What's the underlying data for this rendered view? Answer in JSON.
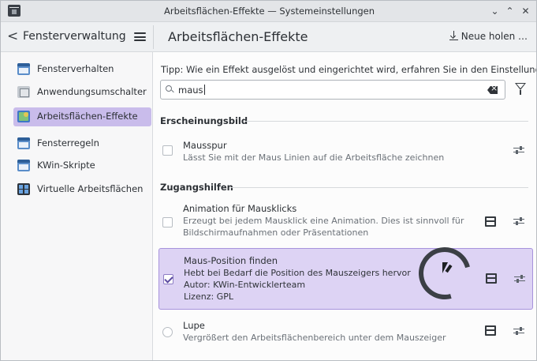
{
  "window": {
    "title": "Arbeitsflächen-Effekte — Systemeinstellungen",
    "controls": [
      "⌄",
      "⌃",
      "✕"
    ]
  },
  "header": {
    "back_label": "<",
    "breadcrumb": "Fensterverwaltung",
    "page_title": "Arbeitsflächen-Effekte",
    "get_new_label": "Neue holen …"
  },
  "sidebar": {
    "items": [
      {
        "label": "Fensterverhalten",
        "icon": "window-icon",
        "active": false
      },
      {
        "label": "Anwendungsumschalter",
        "icon": "task-switcher-icon",
        "active": false
      },
      {
        "label": "Arbeitsflächen-Effekte",
        "icon": "desktop-effects-icon",
        "active": true
      },
      {
        "label": "Fensterregeln",
        "icon": "window-rules-icon",
        "active": false
      },
      {
        "label": "KWin-Skripte",
        "icon": "kwin-scripts-icon",
        "active": false
      },
      {
        "label": "Virtuelle Arbeitsflächen",
        "icon": "virtual-desktops-icon",
        "active": false
      }
    ]
  },
  "main": {
    "tip": "Tipp: Wie ein Effekt ausgelöst und eingerichtet wird, erfahren Sie in den Einstellungen",
    "search": {
      "value": "maus",
      "placeholder": ""
    },
    "sections": [
      {
        "title": "Erscheinungsbild",
        "effects": [
          {
            "name": "Mausspur",
            "description": "Lässt Sie mit der Maus Linien auf die Arbeitsfläche zeichnen",
            "checked": false
          }
        ]
      },
      {
        "title": "Zugangshilfen",
        "effects": [
          {
            "name": "Animation für Mausklicks",
            "description_lines": [
              "Erzeugt bei jedem Mausklick eine Animation. Dies ist sinnvoll für",
              "Bildschirmaufnahmen oder Präsentationen"
            ],
            "checked": false
          },
          {
            "name": "Maus-Position finden",
            "description_lines": [
              "Hebt bei Bedarf die Position des Mauszeigers hervor",
              "Autor: KWin-Entwicklerteam",
              "Lizenz: GPL"
            ],
            "checked": true
          },
          {
            "name": "Lupe",
            "description": "Vergrößert den Arbeitsflächenbereich unter dem Mauszeiger",
            "checked": false
          }
        ]
      }
    ]
  },
  "colors": {
    "accent": "#c9bceb",
    "selection_border": "#a793dc",
    "selection_bg": "#ddd3f4"
  }
}
